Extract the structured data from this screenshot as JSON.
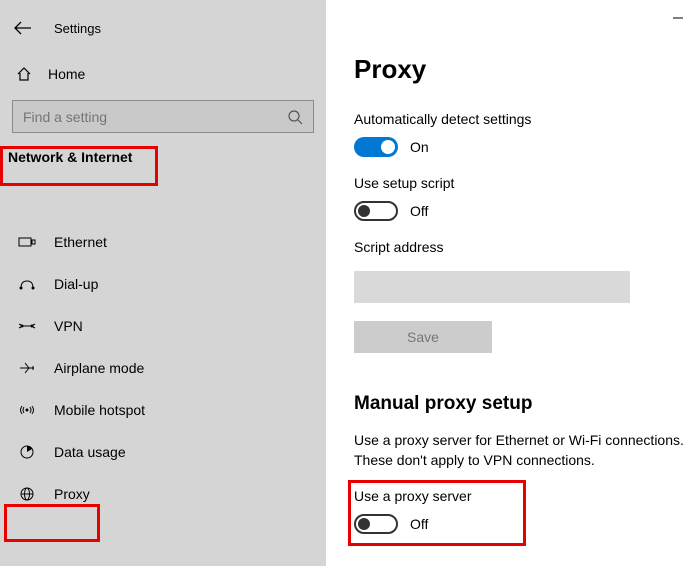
{
  "app": {
    "title": "Settings"
  },
  "sidebar": {
    "home": "Home",
    "search_placeholder": "Find a setting",
    "section": "Network & Internet",
    "items": [
      {
        "label": "Ethernet"
      },
      {
        "label": "Dial-up"
      },
      {
        "label": "VPN"
      },
      {
        "label": "Airplane mode"
      },
      {
        "label": "Mobile hotspot"
      },
      {
        "label": "Data usage"
      },
      {
        "label": "Proxy"
      }
    ]
  },
  "page": {
    "title": "Proxy",
    "auto_detect_label": "Automatically detect settings",
    "auto_detect_state": "On",
    "use_script_label": "Use setup script",
    "use_script_state": "Off",
    "script_address_label": "Script address",
    "save": "Save",
    "manual_heading": "Manual proxy setup",
    "manual_desc": "Use a proxy server for Ethernet or Wi-Fi connections. These don't apply to VPN connections.",
    "use_proxy_label": "Use a proxy server",
    "use_proxy_state": "Off"
  }
}
